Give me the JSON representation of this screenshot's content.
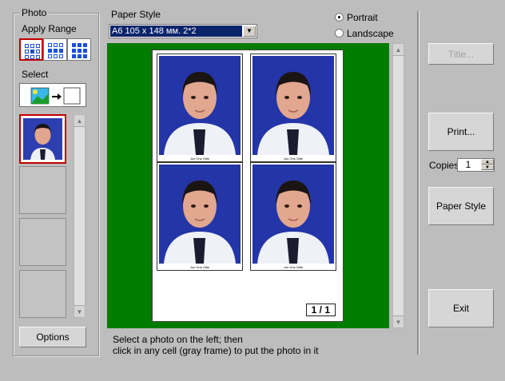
{
  "photo_group": {
    "title": "Photo",
    "apply_range_label": "Apply Range",
    "select_label": "Select",
    "options_button": "Options"
  },
  "paper_style": {
    "label": "Paper Style",
    "selected": "A6 105 x 148 мм. 2*2",
    "orientation_options": [
      "Portrait",
      "Landscape"
    ],
    "orientation_selected": "Portrait"
  },
  "preview": {
    "page_indicator": "1 / 1",
    "cell_caption": "Jun Ons Gitle"
  },
  "instructions": {
    "line1": "Select a photo on the left; then",
    "line2": "click in any cell (gray frame) to put the photo in it"
  },
  "right_panel": {
    "title_button": "Title...",
    "print_button": "Print...",
    "copies_label": "Copies",
    "copies_value": "1",
    "paper_style_button": "Paper Style",
    "exit_button": "Exit"
  },
  "colors": {
    "preview_background": "#007c00",
    "photo_background": "#2435a7",
    "active_border": "#c00000",
    "combo_selection": "#0a246a"
  }
}
